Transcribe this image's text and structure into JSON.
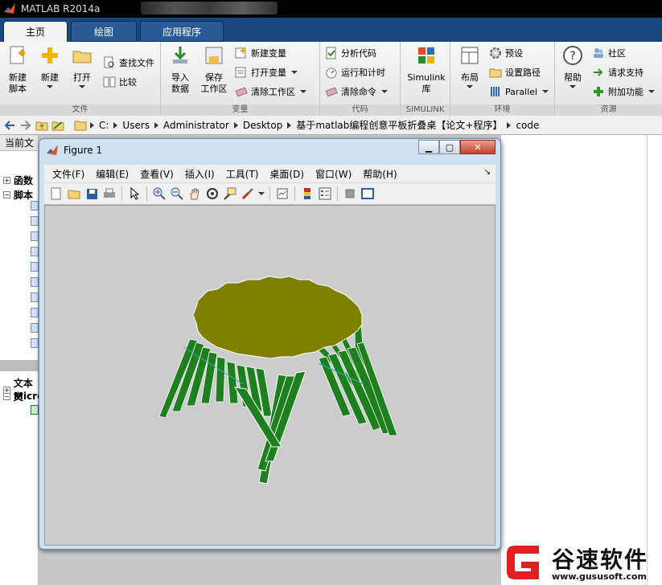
{
  "app": {
    "title": "MATLAB R2014a"
  },
  "tabs": [
    {
      "label": "主页"
    },
    {
      "label": "绘图"
    },
    {
      "label": "应用程序"
    }
  ],
  "ribbon": {
    "file": {
      "label": "文件",
      "new_script": "新建\n脚本",
      "new": "新建",
      "open": "打开",
      "find_files": "查找文件",
      "compare": "比较"
    },
    "variable": {
      "label": "变量",
      "import": "导入\n数据",
      "save_ws": "保存\n工作区",
      "new_var": "新建变量",
      "open_var": "打开变量",
      "clear_ws": "清除工作区"
    },
    "code": {
      "label": "代码",
      "analyze": "分析代码",
      "run_time": "运行和计时",
      "clear_cmd": "清除命令"
    },
    "simulink": {
      "label": "SIMULINK",
      "lib": "Simulink\n库"
    },
    "env": {
      "label": "环境",
      "layout": "布局",
      "prefs": "预设",
      "set_path": "设置路径",
      "parallel": "Parallel"
    },
    "resources": {
      "label": "资源",
      "help": "帮助",
      "community": "社区",
      "support": "请求支持",
      "addons": "附加功能"
    }
  },
  "address": {
    "crumbs": [
      "C:",
      "Users",
      "Administrator",
      "Desktop",
      "基于matlab编程创意平板折叠桌【论文+程序】",
      "code"
    ]
  },
  "left_panel": {
    "header": "当前文",
    "functions": "函数",
    "scripts": "脚本",
    "text_files": "文本文",
    "microsoft": "Micro"
  },
  "figure": {
    "title": "Figure 1",
    "menu": [
      "文件(F)",
      "编辑(E)",
      "查看(V)",
      "插入(I)",
      "工具(T)",
      "桌面(D)",
      "窗口(W)",
      "帮助(H)"
    ],
    "colors": {
      "top": "#808000",
      "legs": "#1e7f1e",
      "background": "#cccccc"
    }
  },
  "watermark": {
    "name": "谷速软件",
    "url": "www.gususoft.com",
    "color": "#e02020"
  }
}
